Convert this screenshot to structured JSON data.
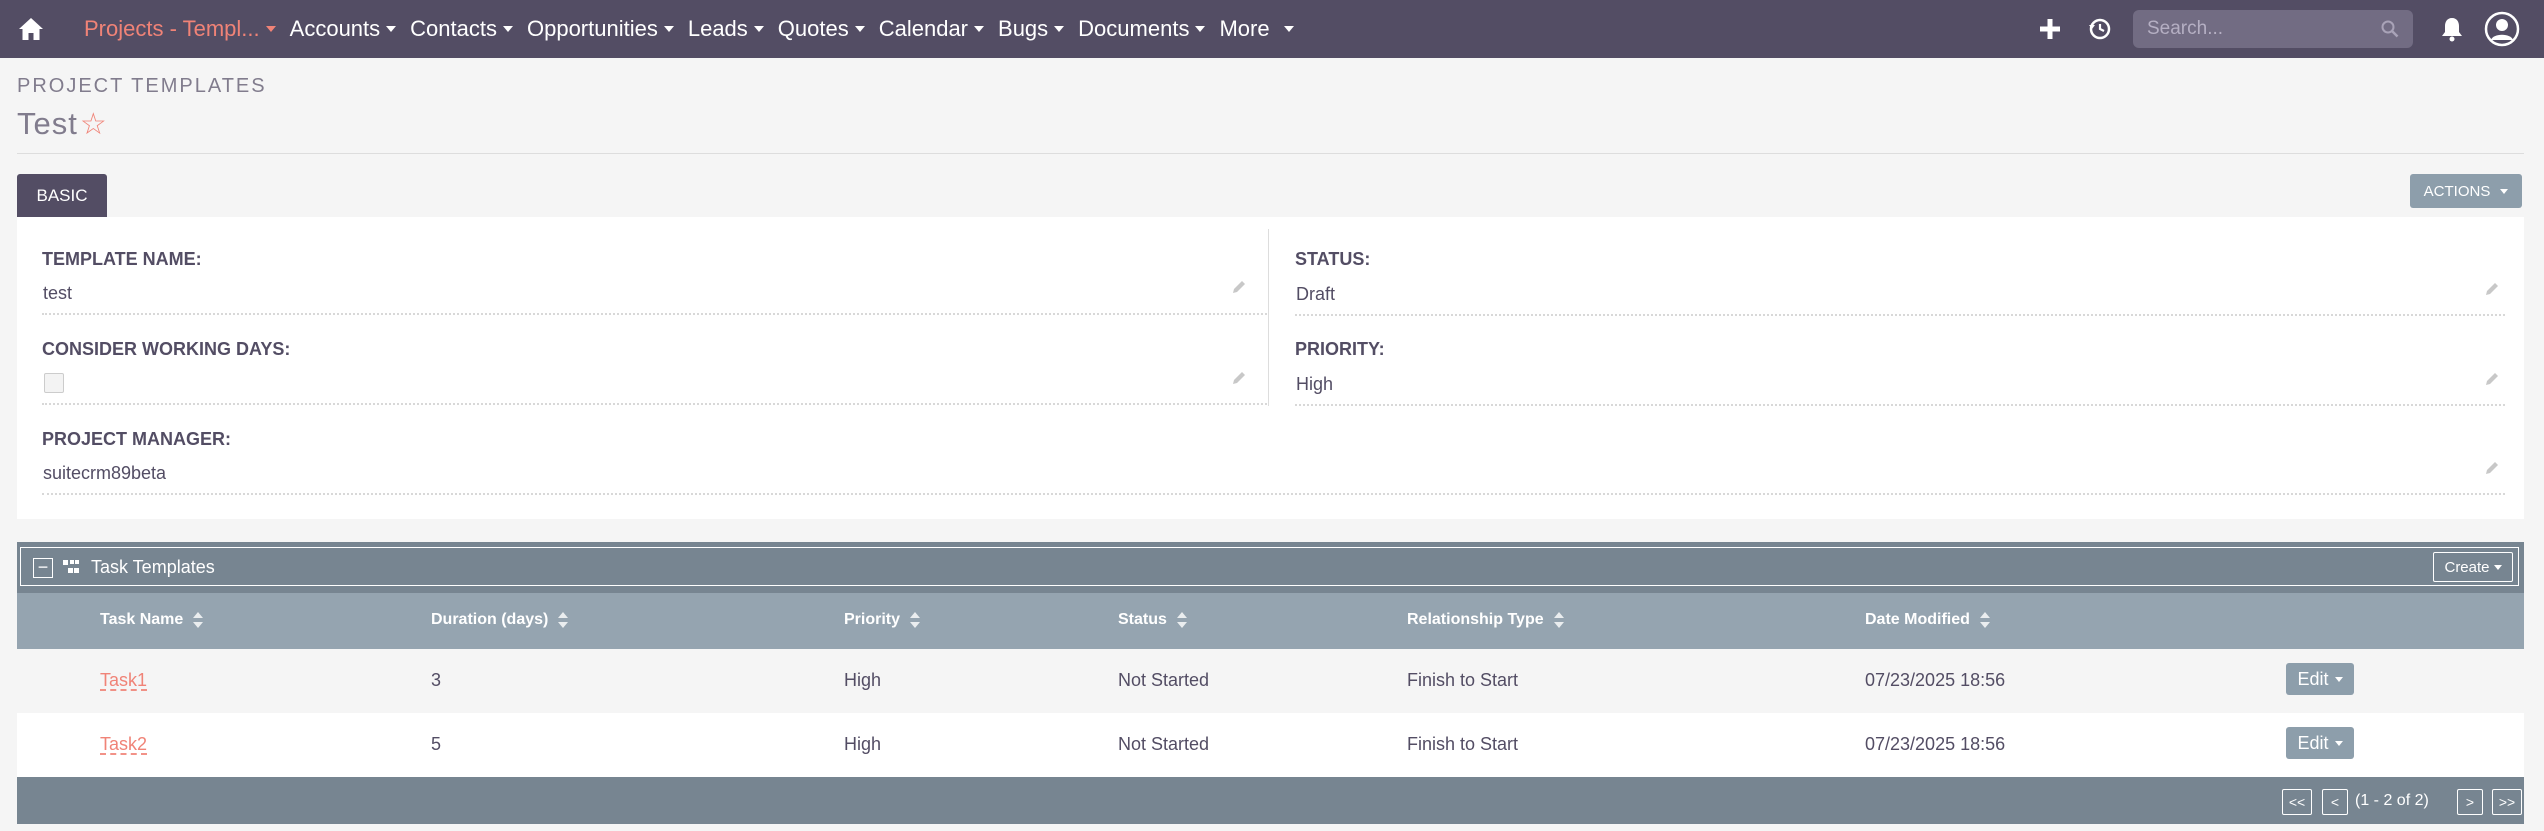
{
  "nav": {
    "active_module": "Projects - Templ...",
    "items": [
      "Accounts",
      "Contacts",
      "Opportunities",
      "Leads",
      "Quotes",
      "Calendar",
      "Bugs",
      "Documents",
      "More"
    ],
    "search_placeholder": "Search...",
    "icons": [
      "home-icon",
      "plus-icon",
      "history-icon",
      "search-icon",
      "bell-icon",
      "user-icon"
    ],
    "bg_color": "#534d64",
    "accent_color": "#f08377"
  },
  "header": {
    "module_title": "PROJECT TEMPLATES",
    "record_title": "Test",
    "favorite_star": "☆"
  },
  "tabs": {
    "basic": "BASIC",
    "actions": "ACTIONS"
  },
  "detail": {
    "template_name_label": "TEMPLATE NAME:",
    "template_name_value": "test",
    "status_label": "STATUS:",
    "status_value": "Draft",
    "working_days_label": "CONSIDER WORKING DAYS:",
    "working_days_checked": false,
    "priority_label": "PRIORITY:",
    "priority_value": "High",
    "manager_label": "PROJECT MANAGER:",
    "manager_value": "suitecrm89beta"
  },
  "subpanel": {
    "title": "Task Templates",
    "collapse": "−",
    "create_label": "Create",
    "columns": [
      "Task Name",
      "Duration (days)",
      "Priority",
      "Status",
      "Relationship Type",
      "Date Modified"
    ],
    "rows": [
      {
        "name": "Task1",
        "duration": "3",
        "priority": "High",
        "status": "Not Started",
        "relationship": "Finish to Start",
        "modified": "07/23/2025 18:56",
        "edit": "Edit"
      },
      {
        "name": "Task2",
        "duration": "5",
        "priority": "High",
        "status": "Not Started",
        "relationship": "Finish to Start",
        "modified": "07/23/2025 18:56",
        "edit": "Edit"
      }
    ],
    "pager": {
      "first": "<<",
      "prev": "<",
      "range": "(1 - 2 of 2)",
      "next": ">",
      "last": ">>"
    }
  }
}
